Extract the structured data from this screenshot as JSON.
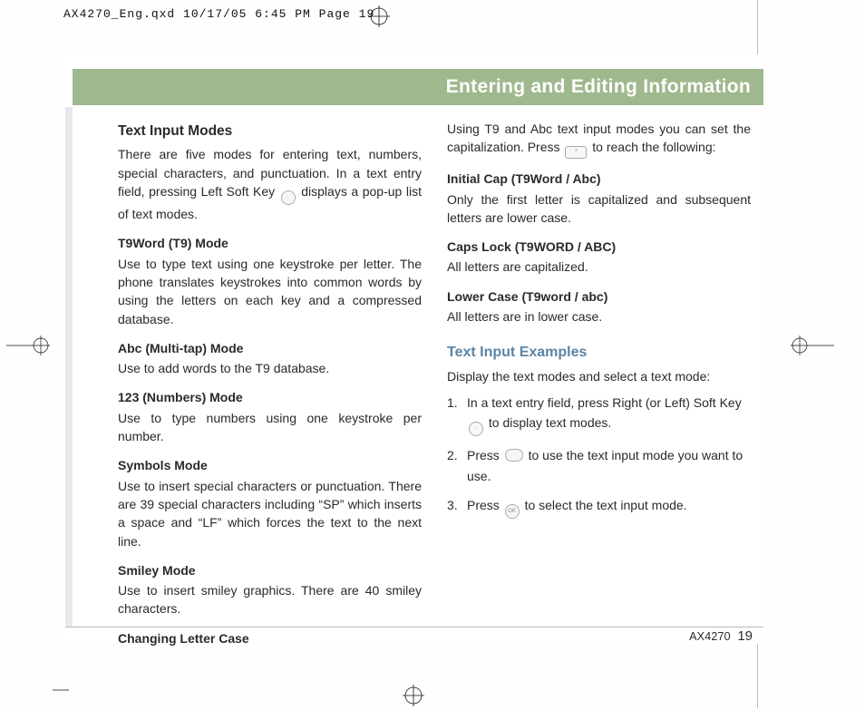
{
  "slug": "AX4270_Eng.qxd  10/17/05  6:45 PM  Page 19",
  "header": {
    "title": "Entering and Editing Information"
  },
  "left": {
    "h1": "Text Input Modes",
    "p1": "There are five modes for entering text, numbers, special characters, and punctuation. In a text entry field, pressing Left Soft Key",
    "p1b": "displays a pop-up list of text modes.",
    "m1": "T9Word (T9) Mode",
    "m1d": "Use to type text using one keystroke per letter. The phone translates keystrokes into common words by using the letters on each key and a compressed database.",
    "m2": "Abc (Multi-tap) Mode",
    "m2d": "Use to add words to the T9 database.",
    "m3": "123 (Numbers) Mode",
    "m3d": "Use to type numbers using one keystroke per number.",
    "m4": "Symbols Mode",
    "m4d": "Use to insert special characters or punctuation. There are 39 special characters including “SP” which inserts a space and “LF” which forces the text to the next line.",
    "m5": "Smiley Mode",
    "m5d": "Use to insert smiley graphics. There are 40 smiley characters.",
    "m6": "Changing Letter Case"
  },
  "right": {
    "p0a": "Using T9 and Abc text input modes you can set the capitalization. Press",
    "p0b": "to reach the following:",
    "c1": "Initial Cap (T9Word / Abc)",
    "c1d": "Only the first letter is capitalized and subsequent letters are lower case.",
    "c2": "Caps Lock (T9WORD / ABC)",
    "c2d": "All letters are capitalized.",
    "c3": "Lower Case (T9word / abc)",
    "c3d": "All letters are in lower case.",
    "hex": "Text Input Examples",
    "exlead": "Display the text modes and select a text mode:",
    "s1a": "In a text entry field, press Right (or Left) Soft Key",
    "s1b": "to display text modes.",
    "s2a": "Press",
    "s2b": "to use the text input mode you want to use.",
    "s3a": "Press",
    "s3b": "to select the text input mode."
  },
  "icons": {
    "softkey": "·",
    "star": "*",
    "nav": " ",
    "ok": "OK"
  },
  "footer": {
    "model": "AX4270",
    "page": "19"
  },
  "steps_nums": {
    "n1": "1.",
    "n2": "2.",
    "n3": "3."
  }
}
